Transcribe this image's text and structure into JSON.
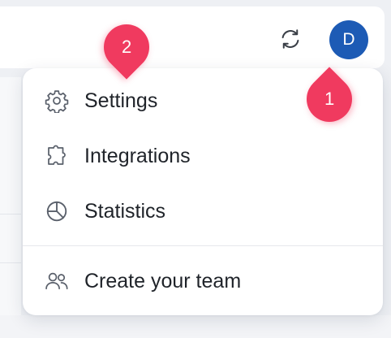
{
  "header": {
    "avatar_initial": "D",
    "avatar_color": "#1d5bb5",
    "sync_icon": "sync-icon"
  },
  "menu": {
    "items": [
      {
        "label": "Settings",
        "icon": "gear-icon"
      },
      {
        "label": "Integrations",
        "icon": "puzzle-icon"
      },
      {
        "label": "Statistics",
        "icon": "pie-chart-icon"
      },
      {
        "label": "Create your team",
        "icon": "users-icon"
      }
    ]
  },
  "annotations": {
    "badge_1": "1",
    "badge_2": "2",
    "badge_color": "#f03a5f"
  }
}
